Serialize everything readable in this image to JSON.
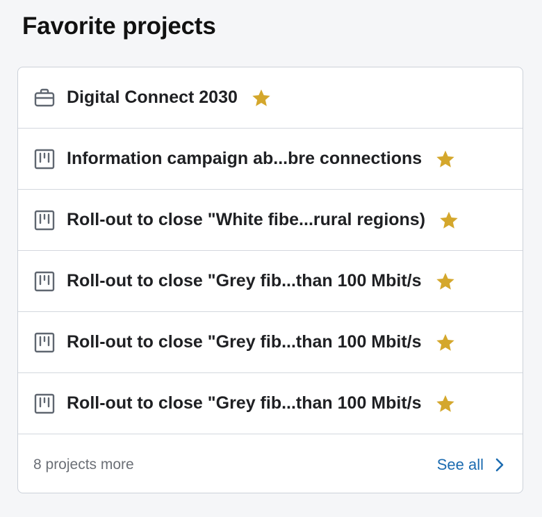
{
  "header": {
    "title": "Favorite projects"
  },
  "projects": [
    {
      "title": "Digital Connect 2030",
      "icon": "briefcase-icon",
      "favorite": true
    },
    {
      "title": "Information campaign ab...bre connections",
      "icon": "board-icon",
      "favorite": true
    },
    {
      "title": "Roll-out to close \"White fibe...rural regions)",
      "icon": "board-icon",
      "favorite": true
    },
    {
      "title": "Roll-out to close \"Grey fib...than 100 Mbit/s",
      "icon": "board-icon",
      "favorite": true
    },
    {
      "title": "Roll-out to close \"Grey fib...than 100 Mbit/s",
      "icon": "board-icon",
      "favorite": true
    },
    {
      "title": "Roll-out to close \"Grey fib...than 100 Mbit/s",
      "icon": "board-icon",
      "favorite": true
    }
  ],
  "footer": {
    "more_text": "8 projects more",
    "see_all_label": "See all"
  },
  "colors": {
    "star": "#d4a72c",
    "link": "#1b6bb0",
    "icon": "#5f6670",
    "border": "#ccd1d9",
    "background": "#f5f6f8"
  }
}
